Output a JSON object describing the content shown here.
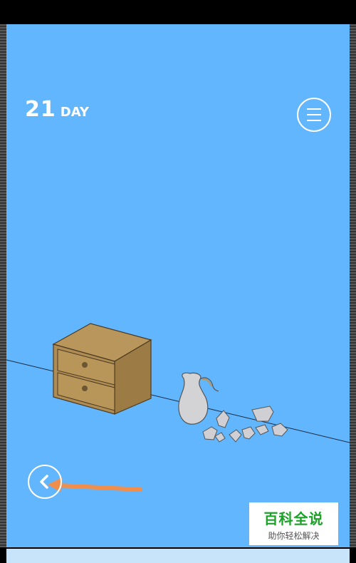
{
  "hud": {
    "day_number": "21",
    "day_label": "DAY"
  },
  "menu": {
    "icon": "hamburger-menu-icon"
  },
  "navigation": {
    "back_icon": "chevron-left-icon"
  },
  "scene": {
    "objects": [
      "nightstand",
      "vase",
      "broken-vase-shards"
    ],
    "background_color": "#62b6fd",
    "hint_arrow_color": "#f28e4b"
  },
  "watermark": {
    "title": "百科全说",
    "subtitle": "助你轻松解决"
  }
}
